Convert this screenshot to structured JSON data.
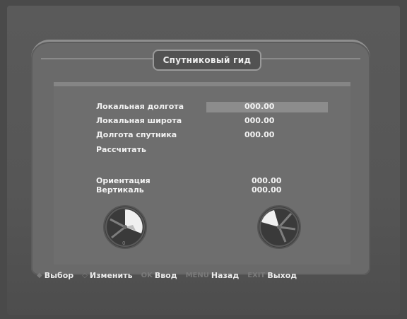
{
  "title": "Спутниковый гид",
  "fields": [
    {
      "label": "Локальная долгота",
      "value": "000.00"
    },
    {
      "label": "Локальная широта",
      "value": "000.00"
    },
    {
      "label": "Долгота спутника",
      "value": "000.00"
    },
    {
      "label": "Рассчитать",
      "value": ""
    }
  ],
  "results": [
    {
      "label": "Ориентация",
      "value": "000.00"
    },
    {
      "label": "Вертикаль",
      "value": "000.00"
    }
  ],
  "dials": {
    "left_icon": "compass-dial-icon",
    "right_icon": "elevation-dial-icon"
  },
  "footer": [
    {
      "key": "◆",
      "label": "Выбор"
    },
    {
      "key": "◇",
      "label": "Изменить"
    },
    {
      "key": "OK",
      "label": "Ввод"
    },
    {
      "key": "MENU",
      "label": "Назад"
    },
    {
      "key": "EXIT",
      "label": "Выход"
    }
  ]
}
